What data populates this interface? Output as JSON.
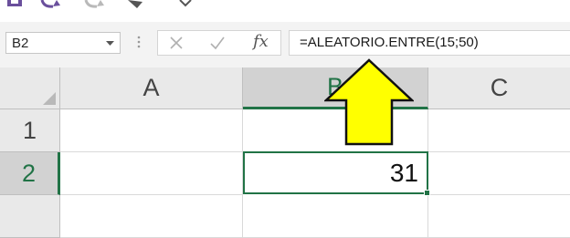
{
  "quick_access_toolbar": {
    "icons": [
      "save-icon",
      "undo-icon",
      "redo-icon",
      "paint-icon",
      "customize-icon"
    ]
  },
  "formula_bar": {
    "name_box": "B2",
    "fx_label": "fx",
    "formula": "=ALEATORIO.ENTRE(15;50)"
  },
  "sheet": {
    "columns": [
      "A",
      "B",
      "C"
    ],
    "rows": [
      "1",
      "2"
    ],
    "active_cell": "B2",
    "cells": {
      "B2": "31"
    }
  },
  "annotation": {
    "arrow_color": "#ffff00",
    "arrow_direction": "up"
  },
  "colors": {
    "selection": "#217346",
    "header": "#e9e9e9",
    "header_selected": "#d2d2d2"
  }
}
